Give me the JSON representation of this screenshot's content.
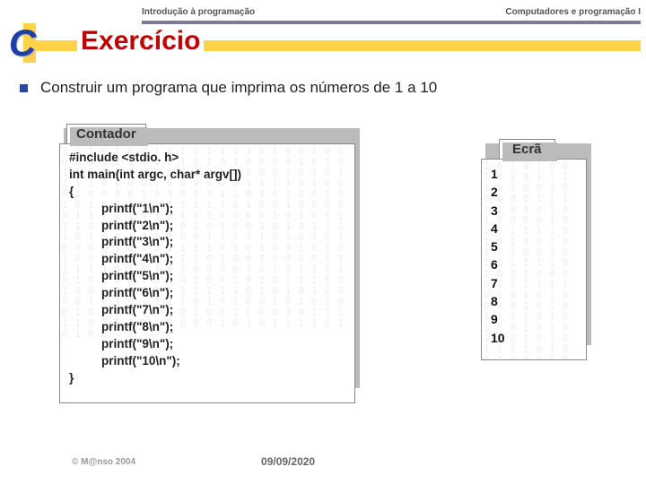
{
  "header": {
    "left": "Introdução à programação",
    "right": "Computadores e programação I"
  },
  "title": "Exercício",
  "logo_letter": "C",
  "bullet": "Construir um  programa que imprima os números de 1 a 10",
  "code": {
    "title": "Contador",
    "lines": [
      {
        "t": "#include <stdio. h>",
        "indent": false
      },
      {
        "t": "int main(int argc, char* argv[])",
        "indent": false
      },
      {
        "t": "{",
        "indent": false
      },
      {
        "t": "printf(\"1\\n\");",
        "indent": true
      },
      {
        "t": "printf(\"2\\n\");",
        "indent": true
      },
      {
        "t": "printf(\"3\\n\");",
        "indent": true
      },
      {
        "t": "printf(\"4\\n\");",
        "indent": true
      },
      {
        "t": "printf(\"5\\n\");",
        "indent": true
      },
      {
        "t": "printf(\"6\\n\");",
        "indent": true
      },
      {
        "t": "printf(\"7\\n\");",
        "indent": true
      },
      {
        "t": "printf(\"8\\n\");",
        "indent": true
      },
      {
        "t": "printf(\"9\\n\");",
        "indent": true
      },
      {
        "t": "printf(\"10\\n\");",
        "indent": true
      },
      {
        "t": "}",
        "indent": false
      }
    ]
  },
  "screen": {
    "title": "Ecrã",
    "lines": [
      "1",
      "2",
      "3",
      "4",
      "5",
      "6",
      "7",
      "8",
      "9",
      "10"
    ]
  },
  "footer": {
    "copyright": "© M@nso 2004",
    "date": "09/09/2020"
  },
  "binary_filler": "101010010101111010010000011111010101000010101111010100101010010101111010010000011111010101000010101111010100101010010101111010010000011111010101000010101111010100101010010101111010010000011111010101000010101111010100101010010101111010010000011111010101000010101111010100101010010101111010010000011111010101000010101111010100101010010101111010010000011111010101000010101111010100"
}
